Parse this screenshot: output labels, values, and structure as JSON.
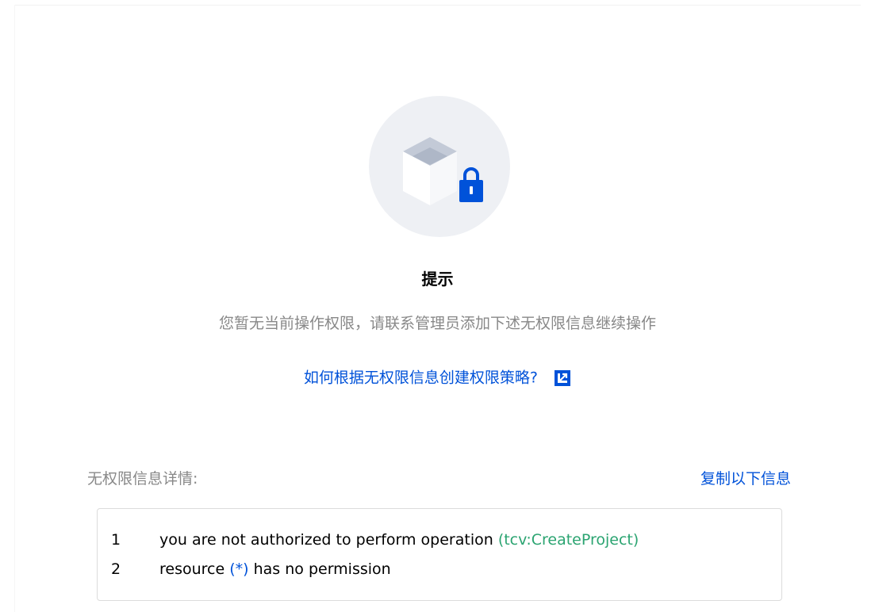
{
  "dialog": {
    "title": "提示",
    "message": "您暂无当前操作权限，请联系管理员添加下述无权限信息继续操作",
    "help_link": {
      "label": "如何根据无权限信息创建权限策略?",
      "icon": "external-link-icon"
    },
    "illustration": {
      "icon": "locked-box-icon"
    },
    "details": {
      "label": "无权限信息详情:",
      "copy_label": "复制以下信息",
      "lines": [
        {
          "number": "1",
          "text": "you are not authorized to perform operation",
          "highlight": "(tcv:CreateProject)"
        },
        {
          "number": "2",
          "prefix": "resource",
          "highlight": "(*)",
          "suffix": "has no permission"
        }
      ]
    }
  },
  "colors": {
    "link": "#0052d9",
    "muted_text": "#888888",
    "highlight_green": "#2ba471",
    "lock_blue": "#0052d9",
    "circle_bg": "#eef0f4"
  }
}
